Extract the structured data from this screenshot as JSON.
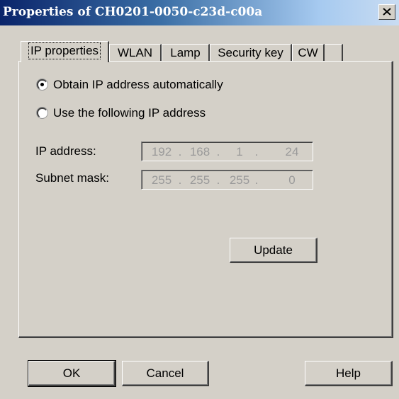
{
  "window": {
    "title": "Properties of CH0201-0050-c23d-c00a"
  },
  "tabs": [
    {
      "label": "IP properties",
      "active": true
    },
    {
      "label": "WLAN",
      "active": false
    },
    {
      "label": "Lamp",
      "active": false
    },
    {
      "label": "Security key",
      "active": false
    },
    {
      "label": "CW",
      "active": false
    }
  ],
  "ip_settings": {
    "option_auto": {
      "label": "Obtain IP address automatically",
      "selected": true
    },
    "option_manual": {
      "label": "Use the following IP address",
      "selected": false
    },
    "ip_address": {
      "label": "IP address:",
      "octets": [
        "192",
        "168",
        "1",
        "24"
      ]
    },
    "subnet_mask": {
      "label": "Subnet mask:",
      "octets": [
        "255",
        "255",
        "255",
        "0"
      ]
    },
    "separator": ".",
    "update_label": "Update"
  },
  "footer": {
    "ok_label": "OK",
    "cancel_label": "Cancel",
    "help_label": "Help"
  },
  "icons": {
    "close": "close-icon"
  },
  "colors": {
    "titlebar_start": "#0a246a",
    "titlebar_end": "#c9dcf2",
    "face": "#d4d0c8",
    "disabled_text": "#9a9a9a"
  }
}
